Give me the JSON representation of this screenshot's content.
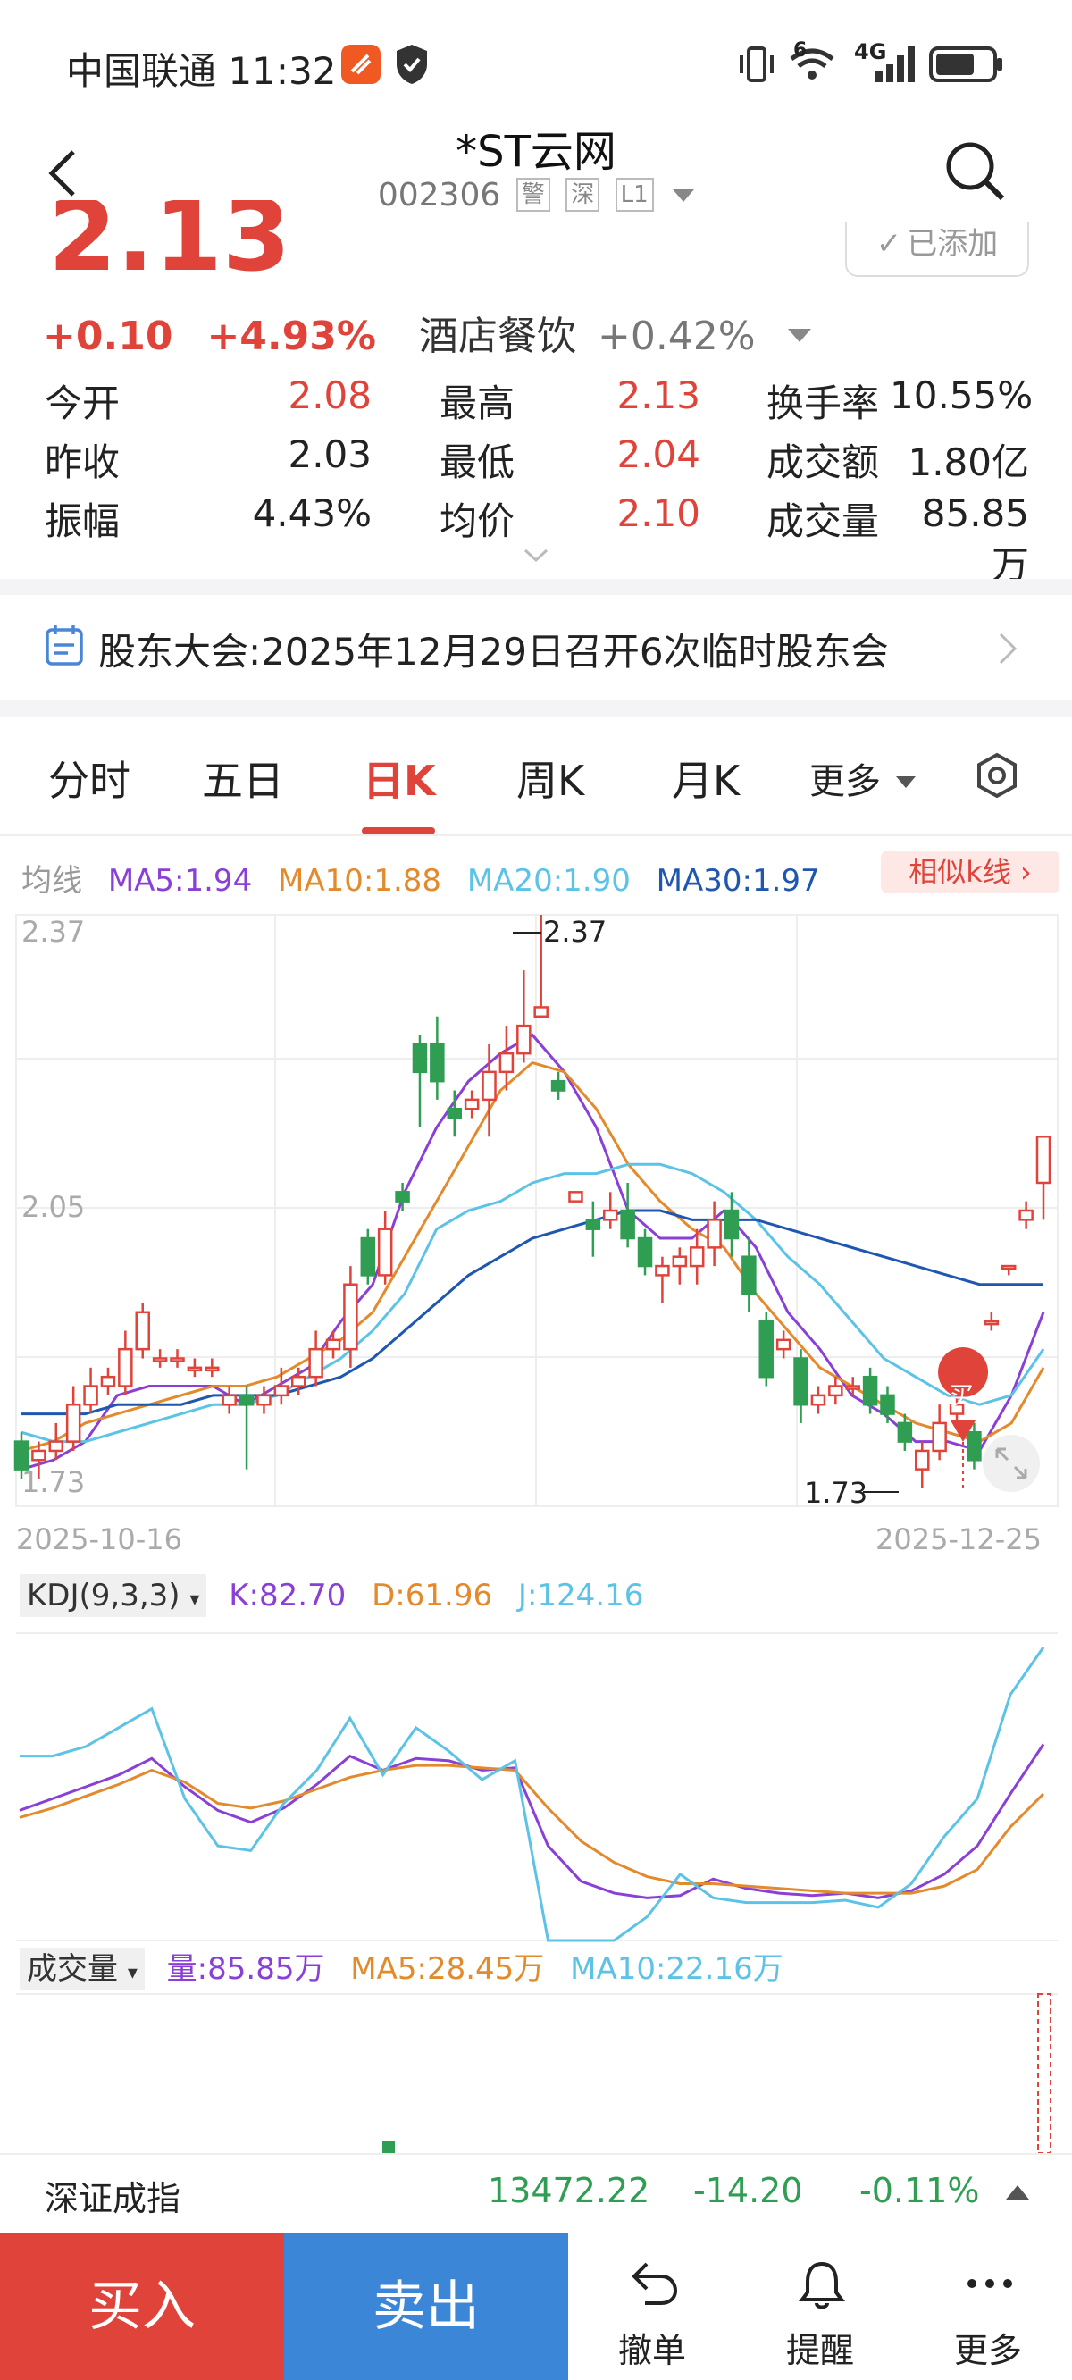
{
  "status_bar": {
    "carrier": "中国联通",
    "time": "11:32",
    "network": "4G",
    "signal_sup": "6"
  },
  "header": {
    "title": "*ST云网",
    "code": "002306",
    "tags": [
      "警",
      "深",
      "L1"
    ]
  },
  "quote": {
    "price": "2.13",
    "change": "+0.10",
    "change_pct": "+4.93%",
    "industry": "酒店餐饮",
    "industry_change": "+0.42%",
    "added_label": "已添加",
    "stats": [
      {
        "label": "今开",
        "value": "2.08"
      },
      {
        "label": "最高",
        "value": "2.13"
      },
      {
        "label": "换手率",
        "value": "10.55%"
      },
      {
        "label": "昨收",
        "value": "2.03"
      },
      {
        "label": "最低",
        "value": "2.04"
      },
      {
        "label": "成交额",
        "value": "1.80亿"
      },
      {
        "label": "振幅",
        "value": "4.43%"
      },
      {
        "label": "均价",
        "value": "2.10"
      },
      {
        "label": "成交量",
        "value": "85.85万"
      }
    ]
  },
  "notice": {
    "text": "股东大会:2025年12月29日召开6次临时股东会"
  },
  "tabs": [
    "分时",
    "五日",
    "日K",
    "周K",
    "月K",
    "更多"
  ],
  "active_tab": "日K",
  "ma_legend": {
    "label": "均线",
    "ma5": "MA5:1.94",
    "ma10": "MA10:1.88",
    "ma20": "MA20:1.90",
    "ma30": "MA30:1.97"
  },
  "similar_k_label": "相似k线 ›",
  "colors": {
    "up": "#e0433a",
    "down": "#2f9e52",
    "ma5": "#8a3fd6",
    "ma10": "#e38a2c",
    "ma20": "#5cc3e6",
    "ma30": "#1f57b0"
  },
  "chart_data": [
    {
      "type": "candlestick",
      "y_ticks": [
        "2.37",
        "2.05",
        "1.73"
      ],
      "x_labels": [
        "2025-10-16",
        "2025-12-25"
      ],
      "high_marker": "2.37",
      "low_marker": "1.73",
      "buy_marker": "买",
      "ylim": [
        1.73,
        2.37
      ],
      "series_names": [
        "MA5",
        "MA10",
        "MA20",
        "MA30"
      ]
    },
    {
      "type": "line",
      "legend": {
        "name": "KDJ(9,3,3)",
        "k": "K:82.70",
        "d": "D:61.96",
        "j": "J:124.16"
      }
    },
    {
      "type": "bar",
      "legend": {
        "name": "成交量",
        "vol": "量:85.85万",
        "ma5": "MA5:28.45万",
        "ma10": "MA10:22.16万"
      }
    }
  ],
  "index_bar": {
    "name": "深证成指",
    "value": "13472.22",
    "change": "-14.20",
    "change_pct": "-0.11%"
  },
  "bottom_bar": {
    "buy": "买入",
    "sell": "卖出",
    "cancel": "撤单",
    "alert": "提醒",
    "more": "更多"
  }
}
